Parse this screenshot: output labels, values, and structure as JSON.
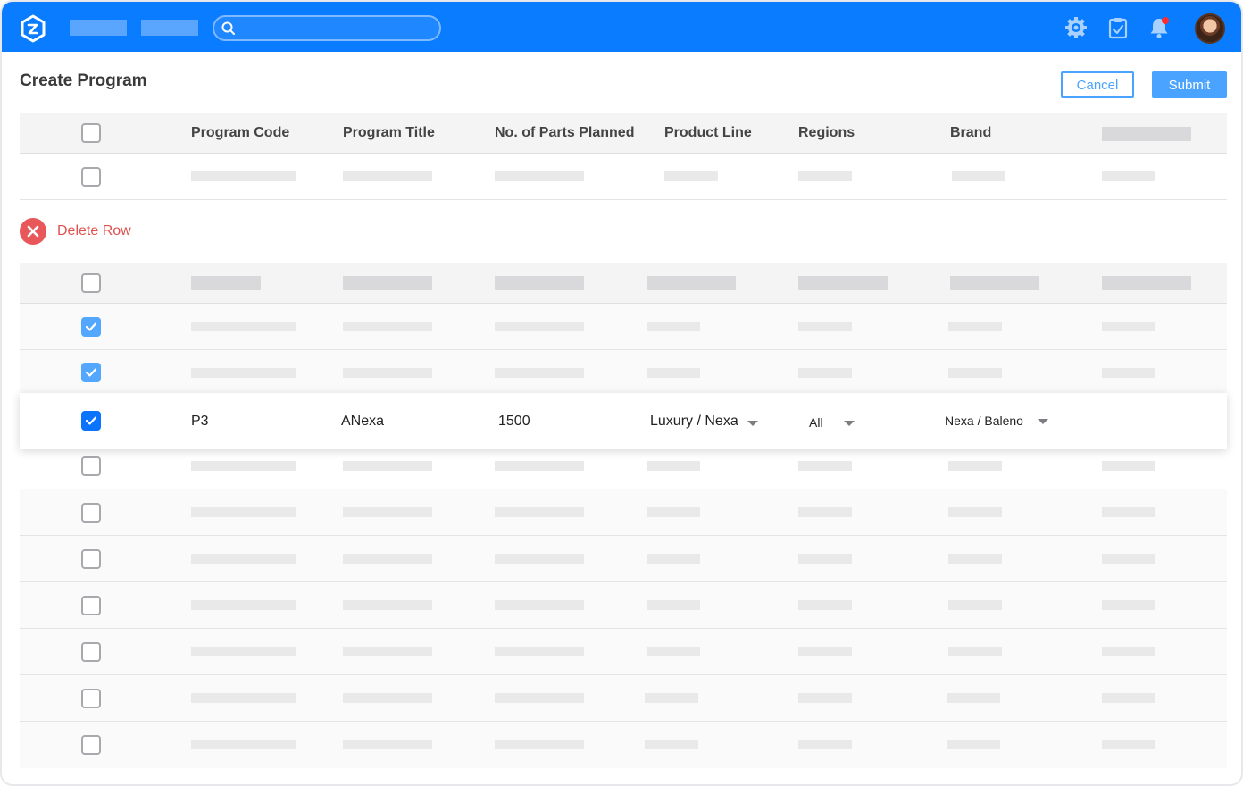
{
  "page": {
    "title": "Create Program"
  },
  "actions": {
    "cancel_label": "Cancel",
    "submit_label": "Submit"
  },
  "table": {
    "columns": [
      "Program Code",
      "Program Title",
      "No. of Parts Planned",
      "Product Line",
      "Regions",
      "Brand"
    ]
  },
  "delete_row": {
    "label": "Delete Row"
  },
  "selected_row": {
    "program_code": "P3",
    "program_title": "ANexa",
    "parts_planned": "1500",
    "product_line": "Luxury / Nexa",
    "regions": "All",
    "brand": "Nexa / Baleno"
  },
  "colors": {
    "topbar": "#0a7cff",
    "accent": "#4aa3ff",
    "danger": "#e8585a"
  },
  "icons": [
    "logo-icon",
    "search-icon",
    "settings-gear-icon",
    "clipboard-check-icon",
    "bell-icon",
    "avatar",
    "close-icon",
    "check-icon",
    "chevron-down-icon"
  ]
}
